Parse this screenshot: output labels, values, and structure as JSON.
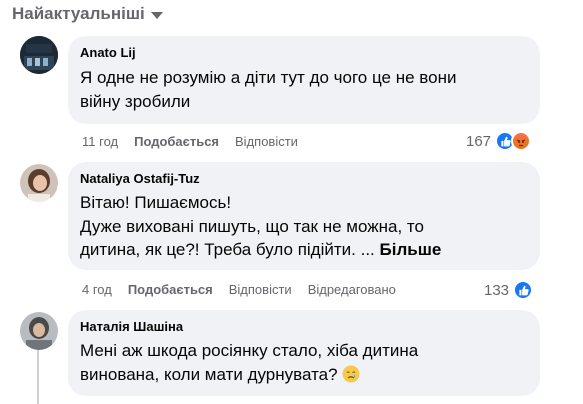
{
  "sort": {
    "label": "Найактуальніші"
  },
  "comments": [
    {
      "author": "Anato Lij",
      "lines": [
        "Я одне не розумію а діти тут до чого це не вони",
        "війну зробили"
      ],
      "time": "11 год",
      "like": "Подобається",
      "reply": "Відповісти",
      "reactions_count": "167",
      "reactions": [
        "like-icon",
        "angry-icon"
      ]
    },
    {
      "author": "Nataliya Ostafij-Tuz",
      "lines": [
        "Вітаю! Пишаємось!",
        "Дуже виховані пишуть, що так не можна, то",
        "дитина, як це?! Треба було підійти. ..."
      ],
      "more": "Більше",
      "time": "4 год",
      "like": "Подобається",
      "reply": "Відповісти",
      "edited": "Відредаговано",
      "reactions_count": "133",
      "reactions": [
        "like-icon"
      ]
    },
    {
      "author": "Наталія Шашіна",
      "lines": [
        "Мені аж шкода росіянку стало, хіба дитина",
        "винована, коли мати дурнувата?"
      ],
      "emoji": "crying-face-icon"
    }
  ],
  "colors": {
    "bubble": "#f0f2f5",
    "meta": "#65676b",
    "like": "#1877f2",
    "angry": "#e9710f"
  }
}
